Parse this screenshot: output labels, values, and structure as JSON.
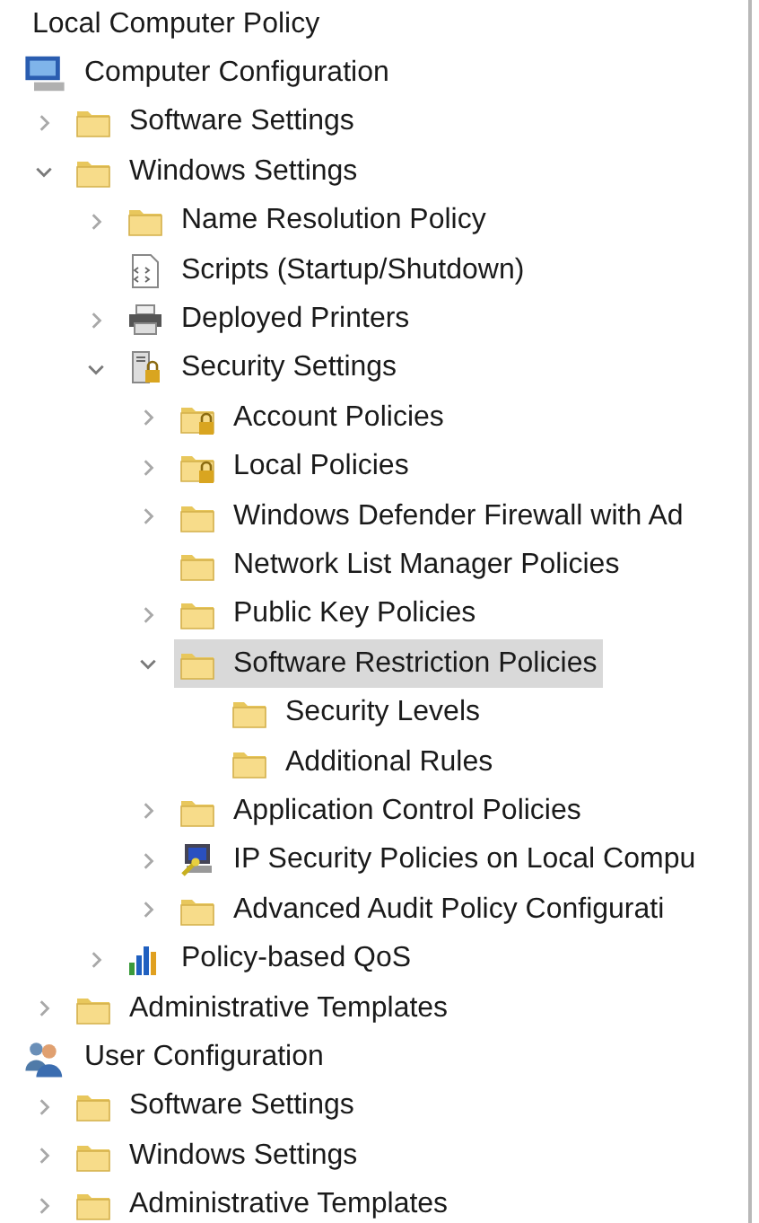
{
  "tree": [
    {
      "label": "Local Computer Policy",
      "selected": false,
      "children": [
        {
          "label": "Computer Configuration",
          "kind": "computer",
          "selected": false,
          "children": [
            {
              "label": "Software Settings",
              "kind": "folder",
              "expanded": false,
              "selected": false
            },
            {
              "label": "Windows Settings",
              "kind": "folder",
              "expanded": true,
              "selected": false,
              "children": [
                {
                  "label": "Name Resolution Policy",
                  "kind": "folder",
                  "expanded": false,
                  "selected": false
                },
                {
                  "label": "Scripts (Startup/Shutdown)",
                  "kind": "script",
                  "selected": false
                },
                {
                  "label": "Deployed Printers",
                  "kind": "printer",
                  "expanded": false,
                  "selected": false
                },
                {
                  "label": "Security Settings",
                  "kind": "security",
                  "expanded": true,
                  "selected": false,
                  "children": [
                    {
                      "label": "Account Policies",
                      "kind": "locked",
                      "expanded": false,
                      "selected": false
                    },
                    {
                      "label": "Local Policies",
                      "kind": "locked",
                      "expanded": false,
                      "selected": false
                    },
                    {
                      "label": "Windows Defender Firewall with Ad",
                      "kind": "folder",
                      "expanded": false,
                      "selected": false
                    },
                    {
                      "label": "Network List Manager Policies",
                      "kind": "folder",
                      "selected": false
                    },
                    {
                      "label": "Public Key Policies",
                      "kind": "folder",
                      "expanded": false,
                      "selected": false
                    },
                    {
                      "label": "Software Restriction Policies",
                      "kind": "folder",
                      "expanded": true,
                      "selected": true,
                      "children": [
                        {
                          "label": "Security Levels",
                          "kind": "folder",
                          "selected": false
                        },
                        {
                          "label": "Additional Rules",
                          "kind": "folder",
                          "selected": false
                        }
                      ]
                    },
                    {
                      "label": "Application Control Policies",
                      "kind": "folder",
                      "expanded": false,
                      "selected": false
                    },
                    {
                      "label": "IP Security Policies on Local Compu",
                      "kind": "ipsec",
                      "expanded": false,
                      "selected": false
                    },
                    {
                      "label": "Advanced Audit Policy Configurati",
                      "kind": "folder",
                      "expanded": false,
                      "selected": false
                    }
                  ]
                },
                {
                  "label": "Policy-based QoS",
                  "kind": "qos",
                  "expanded": false,
                  "selected": false
                }
              ]
            },
            {
              "label": "Administrative Templates",
              "kind": "folder",
              "expanded": false,
              "selected": false
            }
          ]
        },
        {
          "label": "User Configuration",
          "kind": "user",
          "selected": false,
          "children": [
            {
              "label": "Software Settings",
              "kind": "folder",
              "expanded": false,
              "selected": false
            },
            {
              "label": "Windows Settings",
              "kind": "folder",
              "expanded": false,
              "selected": false
            },
            {
              "label": "Administrative Templates",
              "kind": "folder",
              "expanded": false,
              "selected": false
            }
          ]
        }
      ]
    }
  ]
}
